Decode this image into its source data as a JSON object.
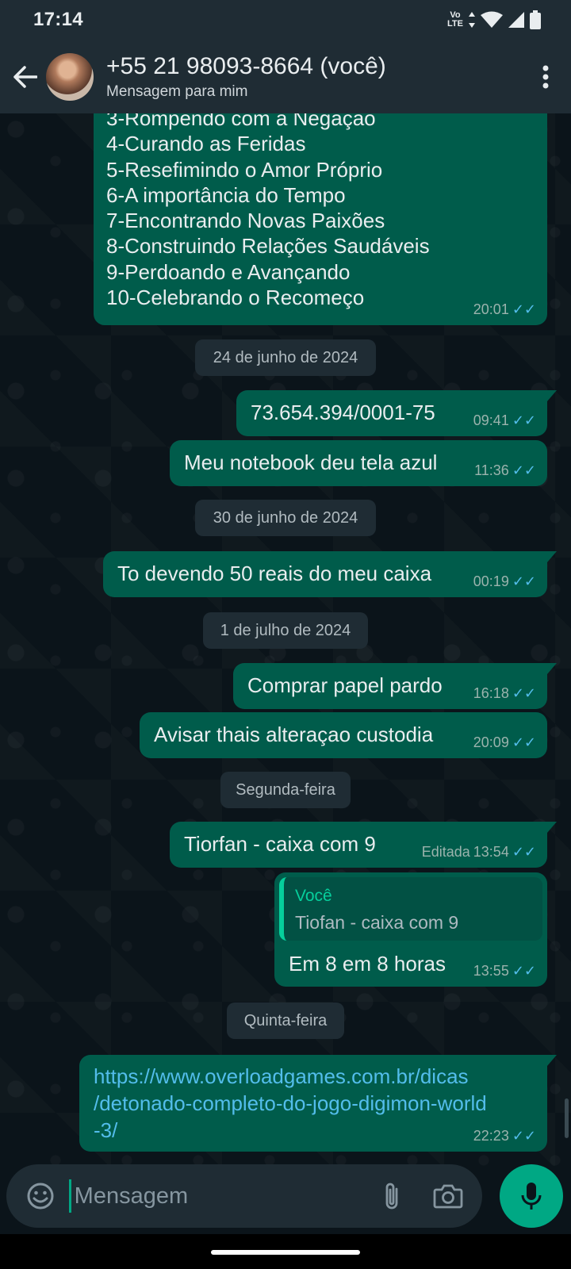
{
  "status_bar": {
    "time": "17:14",
    "volte_top": "Vo",
    "volte_bottom": "LTE"
  },
  "header": {
    "contact_name": "+55 21 98093-8664 (você)",
    "subtitle": "Mensagem para mim"
  },
  "list_bubble": {
    "lines": [
      "3-Rompendo com a Negação",
      "4-Curando as Feridas",
      "5-Resefimindo o Amor Próprio",
      "6-A importância do Tempo",
      "7-Encontrando Novas Paixões",
      "8-Construindo Relações Saudáveis",
      "9-Perdoando e Avançando",
      "10-Celebrando o Recomeço"
    ],
    "time": "20:01"
  },
  "dates": {
    "d1": "24 de junho de 2024",
    "d2": "30 de junho de 2024",
    "d3": "1 de julho de 2024",
    "d4": "Segunda-feira",
    "d5": "Quinta-feira"
  },
  "messages": {
    "m1": {
      "text": "73.654.394/0001-75",
      "time": "09:41"
    },
    "m2": {
      "text": "Meu notebook deu tela azul",
      "time": "11:36"
    },
    "m3": {
      "text": "To devendo 50 reais do meu caixa",
      "time": "00:19"
    },
    "m4": {
      "text": "Comprar papel pardo",
      "time": "16:18"
    },
    "m5": {
      "text": "Avisar thais alteraçao custodia",
      "time": "20:09"
    },
    "m6": {
      "text": "Tiorfan - caixa com 9",
      "time": "13:54",
      "edited": "Editada"
    },
    "m7": {
      "quote_author": "Você",
      "quote_text": "Tiofan - caixa com 9",
      "text": "Em 8 em 8 horas",
      "time": "13:55"
    },
    "m8": {
      "link_lines": [
        "https://www.overloadgames.com.br/dicas",
        "/detonado-completo-do-jogo-digimon-world",
        "-3/"
      ],
      "time": "22:23"
    }
  },
  "read_ticks": "✓✓",
  "composer": {
    "placeholder": "Mensagem"
  },
  "colors": {
    "background": "#0b141a",
    "bar": "#1f2c34",
    "outgoing_bubble": "#005c4b",
    "accent": "#00a884",
    "tick_blue": "#53bdeb"
  }
}
